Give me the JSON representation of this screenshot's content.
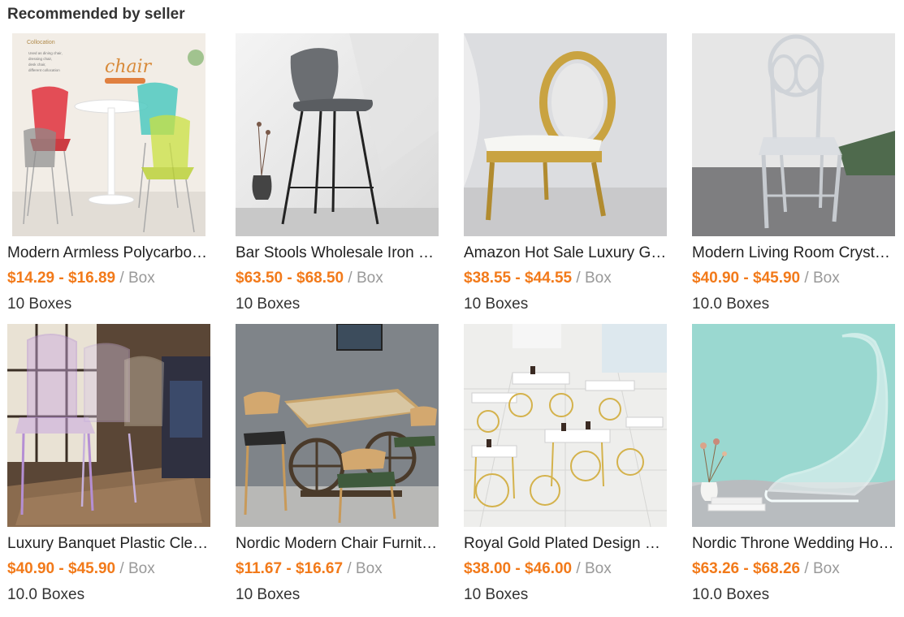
{
  "section": {
    "title": "Recommended by seller"
  },
  "products": [
    {
      "name": "Modern Armless Polycarbonate Chair",
      "price": "$14.29 - $16.89",
      "unit": "/ Box",
      "moq": "10 Boxes",
      "image_icon": "chair-image",
      "image_text": {
        "collocation": "Collocation",
        "chair": "chair",
        "lines": [
          "Used as dining chair,",
          "dressing chair,",
          "desk chair,",
          "different collocation"
        ]
      }
    },
    {
      "name": "Bar Stools Wholesale Iron Leather",
      "price": "$63.50 - $68.50",
      "unit": "/ Box",
      "moq": "10 Boxes",
      "image_icon": "bar-stool-image"
    },
    {
      "name": "Amazon Hot Sale Luxury Gold",
      "price": "$38.55 - $44.55",
      "unit": "/ Box",
      "moq": "10 Boxes",
      "image_icon": "gold-chair-image"
    },
    {
      "name": "Modern Living Room Crystal Chair",
      "price": "$40.90 - $45.90",
      "unit": "/ Box",
      "moq": "10.0 Boxes",
      "image_icon": "crystal-chair-image"
    },
    {
      "name": "Luxury Banquet Plastic Clear Chair",
      "price": "$40.90 - $45.90",
      "unit": "/ Box",
      "moq": "10.0 Boxes",
      "image_icon": "banquet-chair-image"
    },
    {
      "name": "Nordic Modern Chair Furniture Set",
      "price": "$11.67 - $16.67",
      "unit": "/ Box",
      "moq": "10 Boxes",
      "image_icon": "dining-set-image"
    },
    {
      "name": "Royal Gold Plated Design Chairs",
      "price": "$38.00 - $46.00",
      "unit": "/ Box",
      "moq": "10 Boxes",
      "image_icon": "restaurant-image"
    },
    {
      "name": "Nordic Throne Wedding Home Chair",
      "price": "$63.26 - $68.26",
      "unit": "/ Box",
      "moq": "10.0 Boxes",
      "image_icon": "panton-chair-image"
    }
  ],
  "colors": {
    "price": "#f27a1a",
    "unit": "#999999",
    "title": "#333333"
  }
}
